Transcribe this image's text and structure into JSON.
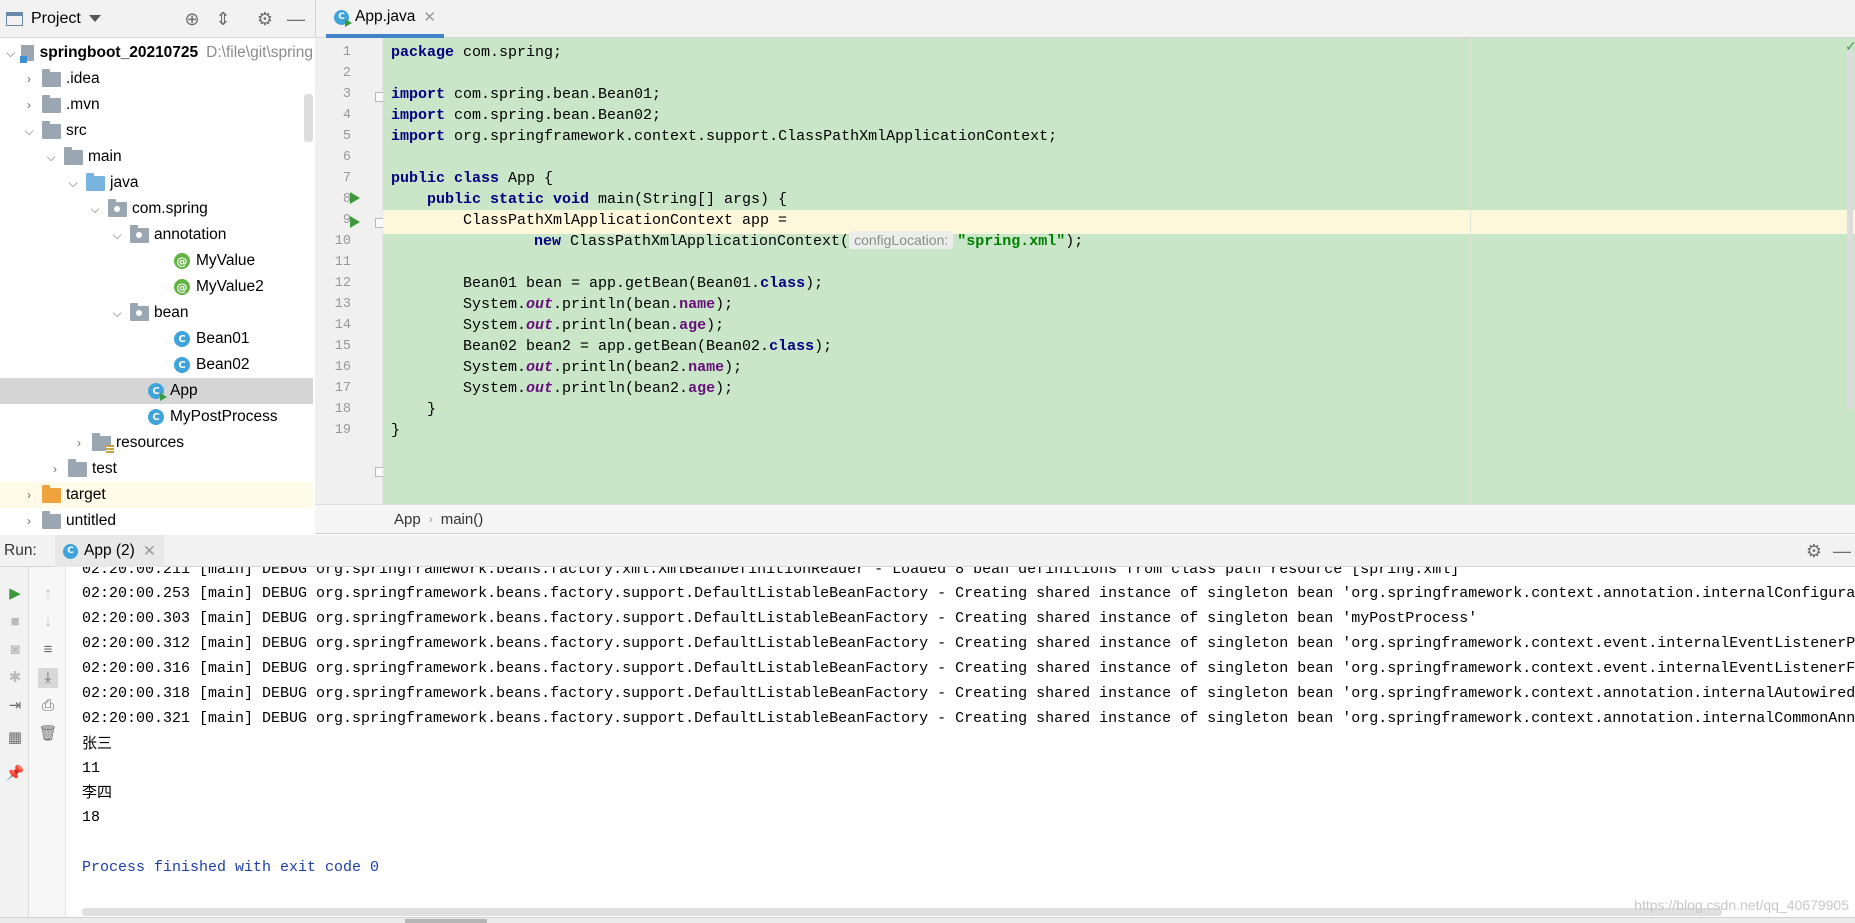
{
  "project_panel": {
    "title": "Project",
    "tree": [
      {
        "label": "springboot_20210725",
        "path": "D:\\file\\git\\spring"
      },
      {
        "label": ".idea"
      },
      {
        "label": ".mvn"
      },
      {
        "label": "src"
      },
      {
        "label": "main"
      },
      {
        "label": "java"
      },
      {
        "label": "com.spring"
      },
      {
        "label": "annotation"
      },
      {
        "label": "MyValue"
      },
      {
        "label": "MyValue2"
      },
      {
        "label": "bean"
      },
      {
        "label": "Bean01"
      },
      {
        "label": "Bean02"
      },
      {
        "label": "App"
      },
      {
        "label": "MyPostProcess"
      },
      {
        "label": "resources"
      },
      {
        "label": "test"
      },
      {
        "label": "target"
      },
      {
        "label": "untitled"
      }
    ]
  },
  "editor": {
    "tab_label": "App.java",
    "line_numbers": [
      "1",
      "2",
      "3",
      "4",
      "5",
      "6",
      "7",
      "8",
      "9",
      "10",
      "11",
      "12",
      "13",
      "14",
      "15",
      "16",
      "17",
      "18",
      "19"
    ],
    "param_hint": "configLocation:",
    "code": {
      "l1_kw": "package",
      "l1_rest": " com.spring;",
      "l3_kw": "import",
      "l3_rest": " com.spring.bean.Bean01;",
      "l4_kw": "import",
      "l4_rest": " com.spring.bean.Bean02;",
      "l5_kw": "import",
      "l5_rest": " org.springframework.context.support.ClassPathXmlApplicationContext;",
      "l7_kw": "public class",
      "l7_rest": " App {",
      "l8_kw": "public static void",
      "l8_rest": " main(String[] args) {",
      "l9": "ClassPathXmlApplicationContext app =",
      "l10_kw": "new",
      "l10_mid": " ClassPathXmlApplicationContext(",
      "l10_str": "\"spring.xml\"",
      "l10_end": ");",
      "l12_pre": "Bean01 bean = app.getBean(Bean01.",
      "l12_kw": "class",
      "l12_end": ");",
      "l13_pre": "System.",
      "l13_out": "out",
      "l13_mid": ".println(bean.",
      "l13_fld": "name",
      "l13_end": ");",
      "l14_pre": "System.",
      "l14_out": "out",
      "l14_mid": ".println(bean.",
      "l14_fld": "age",
      "l14_end": ");",
      "l15_pre": "Bean02 bean2 = app.getBean(Bean02.",
      "l15_kw": "class",
      "l15_end": ");",
      "l16_pre": "System.",
      "l16_out": "out",
      "l16_mid": ".println(bean2.",
      "l16_fld": "name",
      "l16_end": ");",
      "l17_pre": "System.",
      "l17_out": "out",
      "l17_mid": ".println(bean2.",
      "l17_fld": "age",
      "l17_end": ");",
      "l18": "}",
      "l19": "}"
    },
    "breadcrumb": [
      "App",
      "main()"
    ]
  },
  "run_panel": {
    "label": "Run:",
    "tab_label": "App (2)",
    "console": [
      "02:20:00.211 [main] DEBUG org.springframework.beans.factory.xml.XmlBeanDefinitionReader - Loaded 8 bean definitions from class path resource [spring.xml]",
      "02:20:00.253 [main] DEBUG org.springframework.beans.factory.support.DefaultListableBeanFactory - Creating shared instance of singleton bean 'org.springframework.context.annotation.internalConfigura",
      "02:20:00.303 [main] DEBUG org.springframework.beans.factory.support.DefaultListableBeanFactory - Creating shared instance of singleton bean 'myPostProcess'",
      "02:20:00.312 [main] DEBUG org.springframework.beans.factory.support.DefaultListableBeanFactory - Creating shared instance of singleton bean 'org.springframework.context.event.internalEventListenerP",
      "02:20:00.316 [main] DEBUG org.springframework.beans.factory.support.DefaultListableBeanFactory - Creating shared instance of singleton bean 'org.springframework.context.event.internalEventListenerF",
      "02:20:00.318 [main] DEBUG org.springframework.beans.factory.support.DefaultListableBeanFactory - Creating shared instance of singleton bean 'org.springframework.context.annotation.internalAutowired",
      "02:20:00.321 [main] DEBUG org.springframework.beans.factory.support.DefaultListableBeanFactory - Creating shared instance of singleton bean 'org.springframework.context.annotation.internalCommonAnn",
      "张三",
      "11",
      "李四",
      "18",
      "Process finished with exit code 0"
    ]
  },
  "watermark": "https://blog.csdn.net/qq_40679905",
  "colors": {
    "editor_bg": "#c9e6c8",
    "current_line": "#fdf8dc",
    "selection": "#d5d5d5",
    "tab_underline": "#4083c9"
  }
}
